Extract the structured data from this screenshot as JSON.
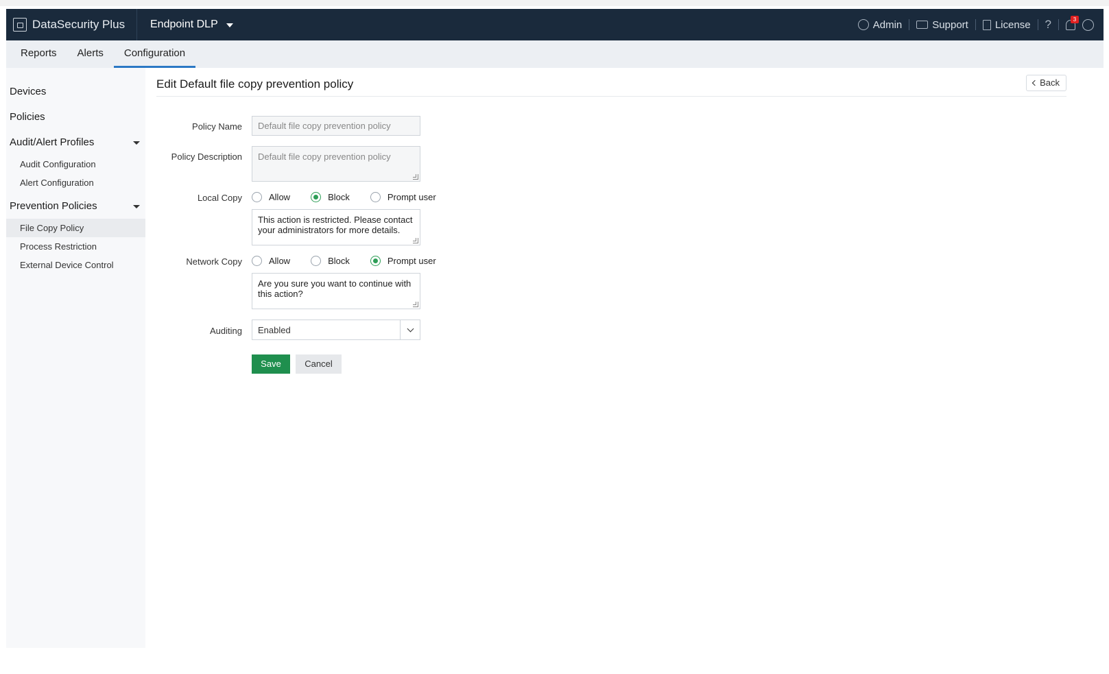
{
  "header": {
    "brand": "DataSecurity Plus",
    "product": "Endpoint DLP",
    "admin": "Admin",
    "support": "Support",
    "license": "License",
    "help": "?",
    "notification_count": "3",
    "brand_icon": "building-lock-icon",
    "admin_icon": "admin-gear-icon",
    "support_icon": "chat-icon",
    "license_icon": "license-icon",
    "user_icon": "user-circle-icon"
  },
  "nav": {
    "tabs": [
      {
        "label": "Reports"
      },
      {
        "label": "Alerts"
      },
      {
        "label": "Configuration",
        "active": true
      }
    ]
  },
  "sidebar": {
    "devices": "Devices",
    "policies": "Policies",
    "audit_alert_profiles": "Audit/Alert Profiles",
    "audit_configuration": "Audit Configuration",
    "alert_configuration": "Alert Configuration",
    "prevention_policies": "Prevention Policies",
    "file_copy_policy": "File Copy Policy",
    "process_restriction": "Process Restriction",
    "external_device_control": "External Device Control"
  },
  "page": {
    "title": "Edit Default file copy prevention policy",
    "back": "Back"
  },
  "form": {
    "policy_name_label": "Policy Name",
    "policy_name_value": "Default file copy prevention policy",
    "policy_description_label": "Policy Description",
    "policy_description_value": "Default file copy prevention policy",
    "local_copy_label": "Local Copy",
    "local_copy_options": [
      "Allow",
      "Block",
      "Prompt user"
    ],
    "local_copy_selected": "Block",
    "local_copy_message": "This action is restricted. Please contact your administrators for more details.",
    "network_copy_label": "Network Copy",
    "network_copy_options": [
      "Allow",
      "Block",
      "Prompt user"
    ],
    "network_copy_selected": "Prompt user",
    "network_copy_message": "Are you sure you want to continue with this action?",
    "auditing_label": "Auditing",
    "auditing_value": "Enabled",
    "save": "Save",
    "cancel": "Cancel"
  },
  "colors": {
    "topbar": "#1a2a3c",
    "accent_blue": "#2a78c4",
    "save_green": "#1f8f4e",
    "radio_green": "#2e9e57",
    "badge_red": "#e02020"
  }
}
